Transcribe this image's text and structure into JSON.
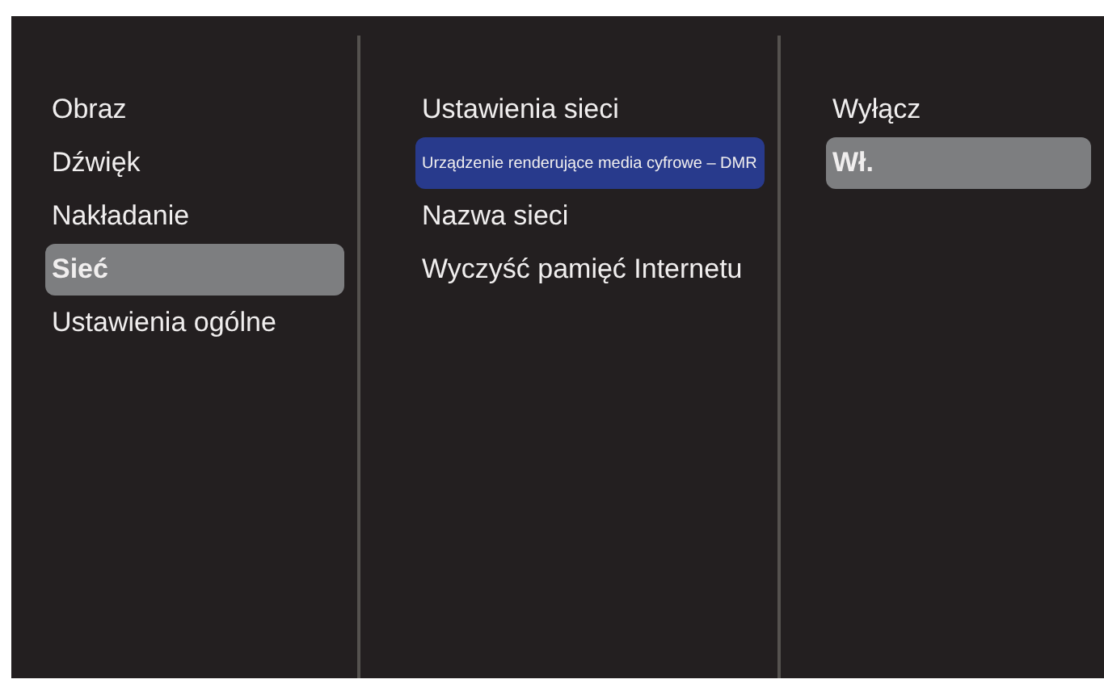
{
  "columns": [
    {
      "kind": "menu",
      "items": [
        {
          "label": "Obraz",
          "selected": false
        },
        {
          "label": "Dźwięk",
          "selected": false
        },
        {
          "label": "Nakładanie",
          "selected": false
        },
        {
          "label": "Sieć",
          "selected": true
        },
        {
          "label": "Ustawienia ogólne",
          "selected": false
        }
      ]
    },
    {
      "kind": "focus",
      "items": [
        {
          "label": "Ustawienia sieci",
          "selected": false
        },
        {
          "label": "Urządzenie renderujące media cyfrowe – DMR",
          "selected": true
        },
        {
          "label": "Nazwa sieci",
          "selected": false
        },
        {
          "label": "Wyczyść pamięć Internetu",
          "selected": false
        }
      ]
    },
    {
      "kind": "menu",
      "items": [
        {
          "label": "Wyłącz",
          "selected": false
        },
        {
          "label": "Wł.",
          "selected": true
        }
      ]
    }
  ]
}
